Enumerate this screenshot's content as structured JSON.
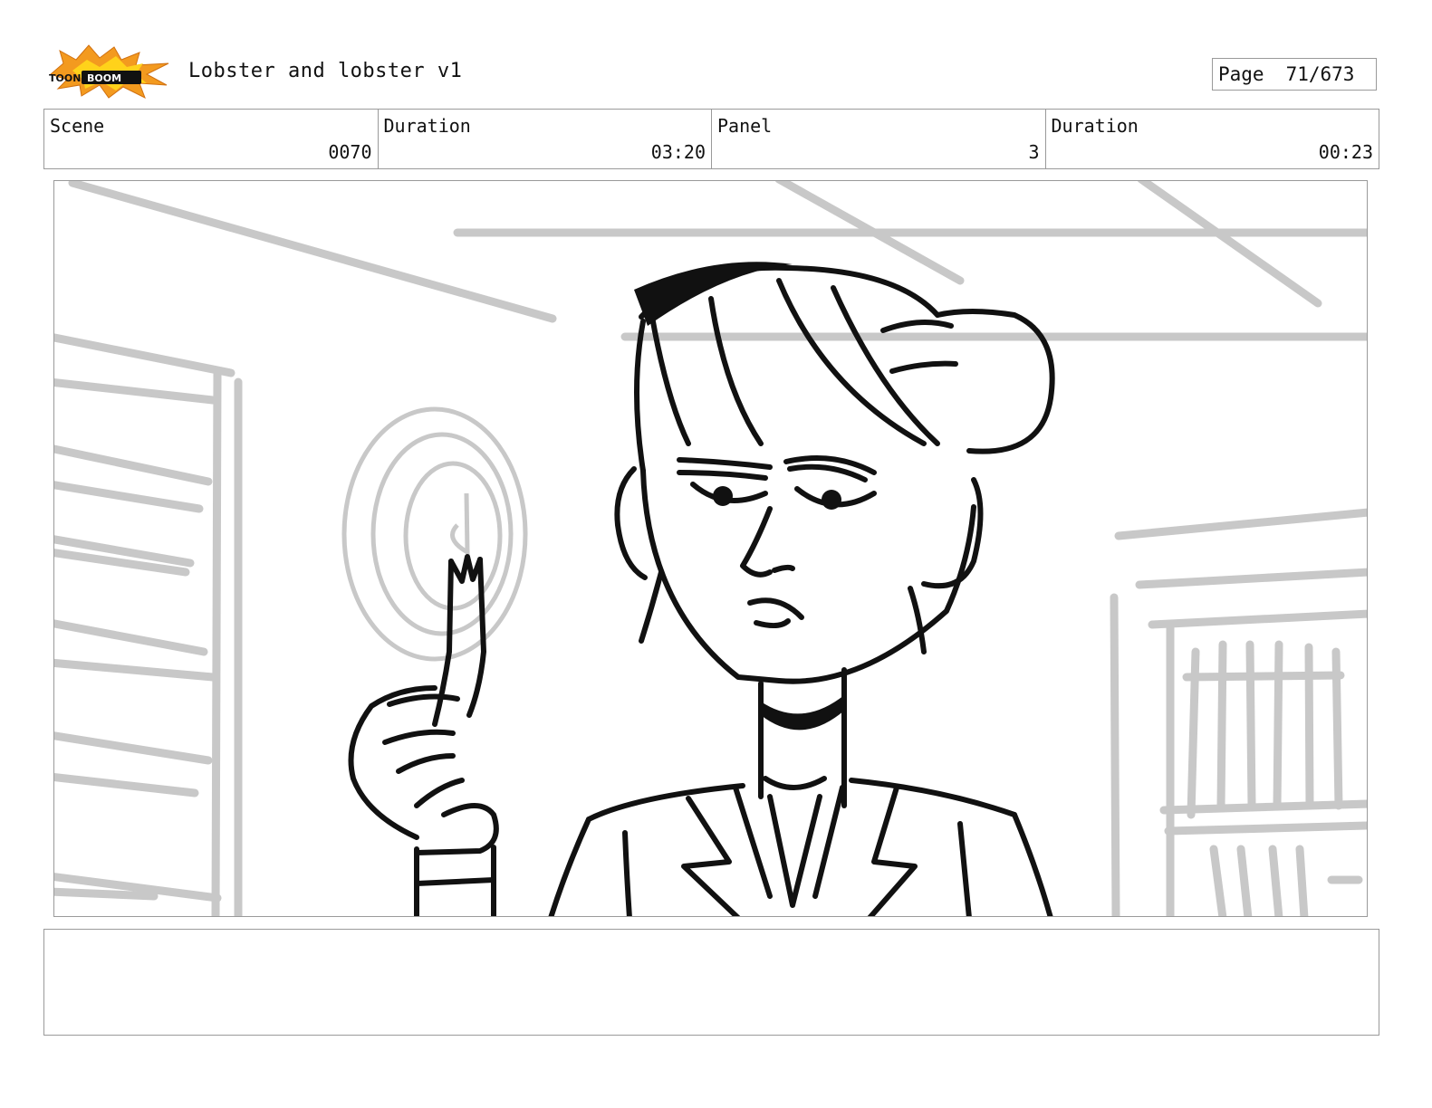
{
  "header": {
    "logo_text": "TOON BOOM",
    "project_title": "Lobster and lobster v1",
    "page_label": "Page",
    "page_value": "71/673"
  },
  "info": [
    {
      "label": "Scene",
      "value": "0070"
    },
    {
      "label": "Duration",
      "value": "03:20"
    },
    {
      "label": "Panel",
      "value": "3"
    },
    {
      "label": "Duration",
      "value": "00:23"
    }
  ],
  "colors": {
    "ink": "#111111",
    "sketch_gray": "#c8c8c8",
    "border": "#9a9a9a",
    "logo_orange": "#f39a1f"
  }
}
